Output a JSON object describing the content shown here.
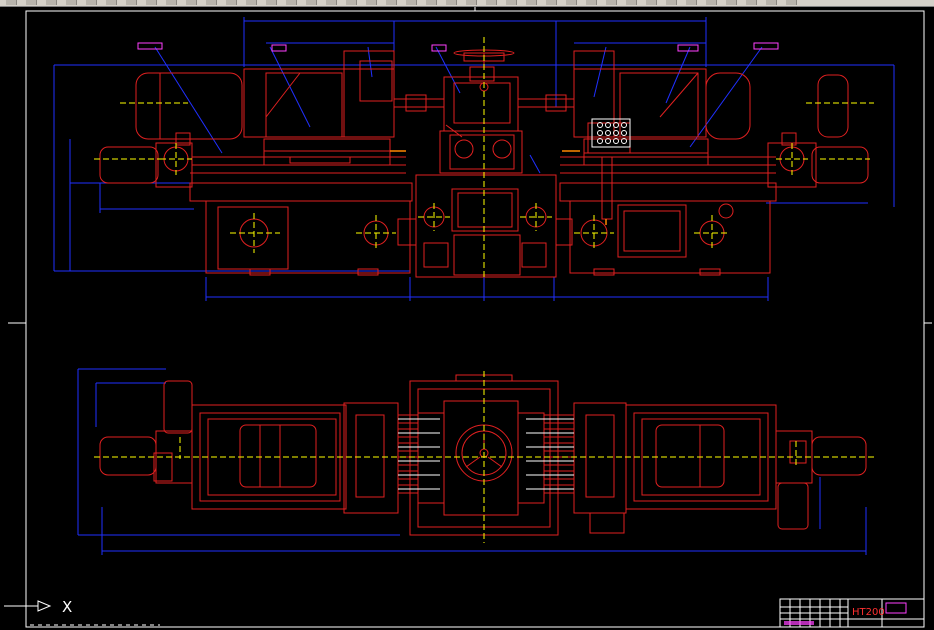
{
  "app": {
    "background_color": "#000000",
    "line_color_main": "#e02020",
    "line_color_dim": "#2030ff",
    "line_color_center": "#ffff00",
    "line_color_border": "#ffffff"
  },
  "toolbar": {
    "icon_count": 40
  },
  "ucs": {
    "x_label": "X"
  },
  "title_block": {
    "material": "HT200"
  }
}
